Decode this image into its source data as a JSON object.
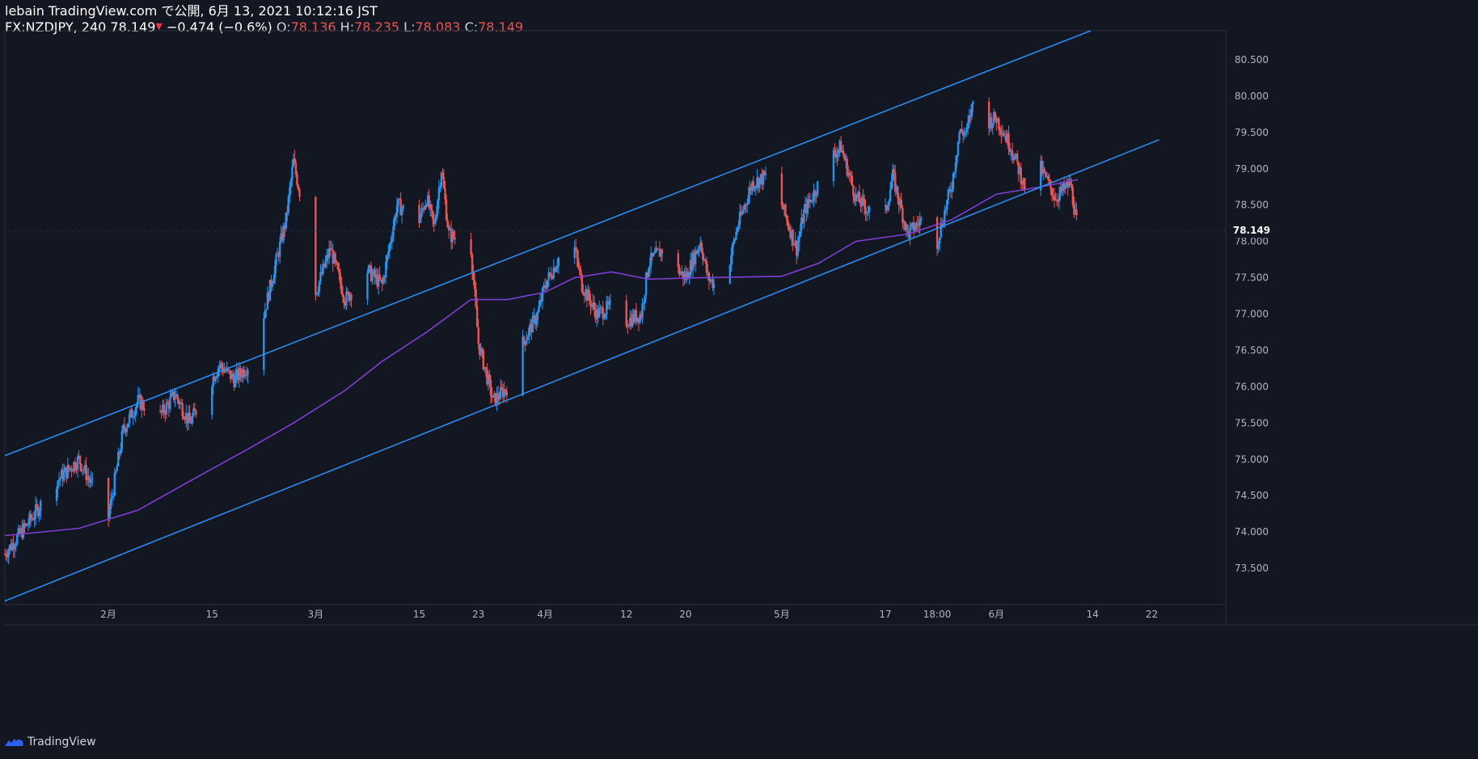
{
  "header": {
    "publish_line": "lebain TradingView.com で公開, 6月 13, 2021 10:12:16 JST",
    "symbol": "FX:NZDJPY, 240",
    "last": "78.149",
    "change": "−0.474 (−0.6%)",
    "o_label": "O:",
    "o_value": "78.136",
    "h_label": "H:",
    "h_value": "78.235",
    "l_label": "L:",
    "l_value": "78.083",
    "c_label": "C:",
    "c_value": "78.149"
  },
  "footer": {
    "brand": "TradingView",
    "logo_icon": "tradingview-logo-icon"
  },
  "colors": {
    "background": "#131722",
    "bull": "#2196f3",
    "bear": "#ef5350",
    "channel": "#2a8cf0",
    "moving_average": "#7e3fd6",
    "axis_text": "#b2b5be"
  },
  "chart_data": {
    "type": "candlestick",
    "title": "",
    "ylim": [
      73.0,
      80.9
    ],
    "y_ticks": [
      "73.500",
      "74.000",
      "74.500",
      "75.000",
      "75.500",
      "76.000",
      "76.500",
      "77.000",
      "77.500",
      "78.000",
      "78.500",
      "79.000",
      "79.500",
      "80.000",
      "80.500"
    ],
    "x_ticks": [
      "2月",
      "15",
      "3月",
      "15",
      "23",
      "4月",
      "12",
      "20",
      "5月",
      "17",
      "18:00",
      "6月",
      "14",
      "22"
    ],
    "last_price_label": "78.149",
    "close_path": [
      {
        "date": "2021-01-18",
        "price": 73.7
      },
      {
        "date": "2021-01-21",
        "price": 74.1
      },
      {
        "date": "2021-01-25",
        "price": 74.7
      },
      {
        "date": "2021-01-28",
        "price": 75.0
      },
      {
        "date": "2021-02-01",
        "price": 74.2
      },
      {
        "date": "2021-02-03",
        "price": 75.4
      },
      {
        "date": "2021-02-05",
        "price": 75.8
      },
      {
        "date": "2021-02-08",
        "price": 75.6
      },
      {
        "date": "2021-02-10",
        "price": 75.9
      },
      {
        "date": "2021-02-12",
        "price": 75.5
      },
      {
        "date": "2021-02-16",
        "price": 76.3
      },
      {
        "date": "2021-02-18",
        "price": 76.1
      },
      {
        "date": "2021-02-20",
        "price": 76.3
      },
      {
        "date": "2021-02-22",
        "price": 77.0
      },
      {
        "date": "2021-02-25",
        "price": 78.3
      },
      {
        "date": "2021-02-26",
        "price": 79.1
      },
      {
        "date": "2021-02-27",
        "price": 78.6
      },
      {
        "date": "2021-03-01",
        "price": 77.3
      },
      {
        "date": "2021-03-03",
        "price": 77.9
      },
      {
        "date": "2021-03-05",
        "price": 77.2
      },
      {
        "date": "2021-03-08",
        "price": 77.6
      },
      {
        "date": "2021-03-10",
        "price": 77.4
      },
      {
        "date": "2021-03-12",
        "price": 78.5
      },
      {
        "date": "2021-03-15",
        "price": 78.3
      },
      {
        "date": "2021-03-16",
        "price": 78.6
      },
      {
        "date": "2021-03-17",
        "price": 78.2
      },
      {
        "date": "2021-03-18",
        "price": 79.0
      },
      {
        "date": "2021-03-19",
        "price": 78.1
      },
      {
        "date": "2021-03-22",
        "price": 77.9
      },
      {
        "date": "2021-03-23",
        "price": 76.6
      },
      {
        "date": "2021-03-25",
        "price": 75.8
      },
      {
        "date": "2021-03-27",
        "price": 76.0
      },
      {
        "date": "2021-03-29",
        "price": 76.6
      },
      {
        "date": "2021-03-31",
        "price": 77.0
      },
      {
        "date": "2021-04-01",
        "price": 77.4
      },
      {
        "date": "2021-04-03",
        "price": 77.8
      },
      {
        "date": "2021-04-05",
        "price": 77.9
      },
      {
        "date": "2021-04-06",
        "price": 77.4
      },
      {
        "date": "2021-04-08",
        "price": 77.0
      },
      {
        "date": "2021-04-10",
        "price": 77.1
      },
      {
        "date": "2021-04-12",
        "price": 76.9
      },
      {
        "date": "2021-04-14",
        "price": 77.0
      },
      {
        "date": "2021-04-15",
        "price": 77.7
      },
      {
        "date": "2021-04-17",
        "price": 77.9
      },
      {
        "date": "2021-04-19",
        "price": 77.6
      },
      {
        "date": "2021-04-20",
        "price": 77.5
      },
      {
        "date": "2021-04-22",
        "price": 78.0
      },
      {
        "date": "2021-04-23",
        "price": 77.5
      },
      {
        "date": "2021-04-25",
        "price": 77.3
      },
      {
        "date": "2021-04-27",
        "price": 78.2
      },
      {
        "date": "2021-04-29",
        "price": 78.8
      },
      {
        "date": "2021-05-01",
        "price": 78.9
      },
      {
        "date": "2021-05-03",
        "price": 78.5
      },
      {
        "date": "2021-05-05",
        "price": 77.9
      },
      {
        "date": "2021-05-06",
        "price": 78.4
      },
      {
        "date": "2021-05-08",
        "price": 78.8
      },
      {
        "date": "2021-05-10",
        "price": 79.2
      },
      {
        "date": "2021-05-11",
        "price": 79.3
      },
      {
        "date": "2021-05-13",
        "price": 78.6
      },
      {
        "date": "2021-05-15",
        "price": 78.4
      },
      {
        "date": "2021-05-16",
        "price": 79.0
      },
      {
        "date": "2021-05-17",
        "price": 78.4
      },
      {
        "date": "2021-05-18",
        "price": 78.9
      },
      {
        "date": "2021-05-20",
        "price": 78.1
      },
      {
        "date": "2021-05-22",
        "price": 78.3
      },
      {
        "date": "2021-05-24",
        "price": 78.0
      },
      {
        "date": "2021-05-25",
        "price": 78.4
      },
      {
        "date": "2021-05-26",
        "price": 78.8
      },
      {
        "date": "2021-05-27",
        "price": 79.5
      },
      {
        "date": "2021-05-28",
        "price": 79.5
      },
      {
        "date": "2021-05-29",
        "price": 80.0
      },
      {
        "date": "2021-05-30",
        "price": 79.6
      },
      {
        "date": "2021-06-01",
        "price": 79.7
      },
      {
        "date": "2021-06-03",
        "price": 79.3
      },
      {
        "date": "2021-06-05",
        "price": 78.7
      },
      {
        "date": "2021-06-07",
        "price": 79.0
      },
      {
        "date": "2021-06-09",
        "price": 78.6
      },
      {
        "date": "2021-06-11",
        "price": 78.8
      },
      {
        "date": "2021-06-12",
        "price": 78.149
      }
    ],
    "moving_average": [
      {
        "date": "2021-01-18",
        "price": 73.95
      },
      {
        "date": "2021-01-28",
        "price": 74.05
      },
      {
        "date": "2021-02-05",
        "price": 74.3
      },
      {
        "date": "2021-02-12",
        "price": 74.7
      },
      {
        "date": "2021-02-20",
        "price": 75.15
      },
      {
        "date": "2021-02-26",
        "price": 75.5
      },
      {
        "date": "2021-03-05",
        "price": 75.95
      },
      {
        "date": "2021-03-10",
        "price": 76.35
      },
      {
        "date": "2021-03-16",
        "price": 76.75
      },
      {
        "date": "2021-03-22",
        "price": 77.2
      },
      {
        "date": "2021-03-27",
        "price": 77.2
      },
      {
        "date": "2021-04-01",
        "price": 77.3
      },
      {
        "date": "2021-04-05",
        "price": 77.5
      },
      {
        "date": "2021-04-10",
        "price": 77.58
      },
      {
        "date": "2021-04-15",
        "price": 77.48
      },
      {
        "date": "2021-04-22",
        "price": 77.5
      },
      {
        "date": "2021-05-03",
        "price": 77.52
      },
      {
        "date": "2021-05-08",
        "price": 77.7
      },
      {
        "date": "2021-05-13",
        "price": 78.0
      },
      {
        "date": "2021-05-20",
        "price": 78.1
      },
      {
        "date": "2021-05-26",
        "price": 78.3
      },
      {
        "date": "2021-06-01",
        "price": 78.65
      },
      {
        "date": "2021-06-07",
        "price": 78.75
      },
      {
        "date": "2021-06-12",
        "price": 78.85
      }
    ],
    "channel_lines": [
      {
        "name": "upper",
        "from": {
          "date": "2021-01-18",
          "price": 75.05
        },
        "to": {
          "date": "2021-06-15",
          "price": 80.95
        }
      },
      {
        "name": "lower",
        "from": {
          "date": "2021-01-18",
          "price": 73.05
        },
        "to": {
          "date": "2021-06-23",
          "price": 79.4
        }
      }
    ]
  }
}
